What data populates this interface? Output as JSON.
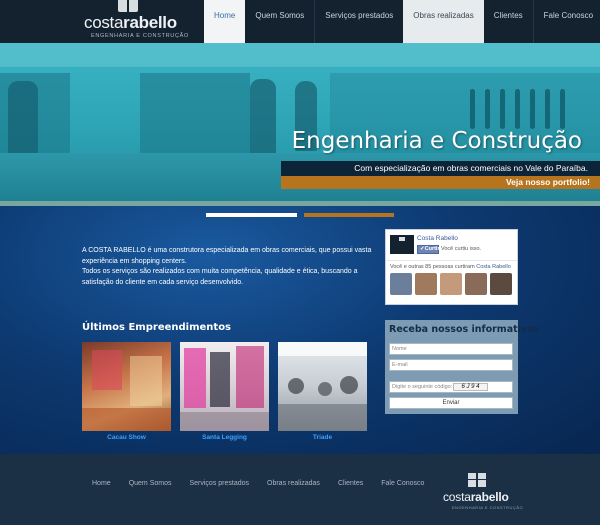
{
  "brand": {
    "name_light": "costa",
    "name_bold": "rabello",
    "tagline": "ENGENHARIA E CONSTRUÇÃO"
  },
  "nav": {
    "items": [
      {
        "label": "Home"
      },
      {
        "label": "Quem Somos"
      },
      {
        "label": "Serviços prestados"
      },
      {
        "label": "Obras realizadas"
      },
      {
        "label": "Clientes"
      },
      {
        "label": "Fale Conosco"
      }
    ]
  },
  "hero": {
    "title": "Engenharia e Construção",
    "subtitle": "Com especialização em obras comerciais no Vale do Paraíba.",
    "cta": "Veja nosso portfolio!"
  },
  "about": {
    "paragraph1": "A COSTA RABELLO é uma construtora especializada em obras comerciais, que possui vasta experiência em shopping centers.",
    "paragraph2": "Todos os serviços são realizados com muita competência, qualidade e ética, buscando a satisfação do cliente em cada serviço desenvolvido."
  },
  "facebook": {
    "page_name": "Costa Rabello",
    "like_label": "Curtir",
    "liked_text": "Você curtiu isso.",
    "count_text": "Você e outras 85 pessoas curtiram",
    "count_link": "Costa Rabello",
    "face_colors": [
      "#6b7f9a",
      "#a07a5c",
      "#c49a7c",
      "#8a6a58",
      "#5a4a40"
    ]
  },
  "projects": {
    "title": "Últimos Empreendimentos",
    "items": [
      {
        "caption": "Cacau Show"
      },
      {
        "caption": "Santa Legging"
      },
      {
        "caption": "Triade"
      }
    ]
  },
  "newsletter": {
    "title": "Receba nossos informativos",
    "name_placeholder": "Nome",
    "email_placeholder": "E-mail",
    "captcha_placeholder": "Digite o seguinte código:",
    "captcha_code": "6 J 9 4",
    "submit_label": "Enviar"
  },
  "footer": {
    "nav": [
      {
        "label": "Home"
      },
      {
        "label": "Quem Somos"
      },
      {
        "label": "Serviços prestados"
      },
      {
        "label": "Obras realizadas"
      },
      {
        "label": "Clientes"
      },
      {
        "label": "Fale Conosco"
      }
    ]
  },
  "colors": {
    "header_bg": "#142230",
    "accent_orange": "#b7741f",
    "link_blue": "#3ea0ff"
  }
}
